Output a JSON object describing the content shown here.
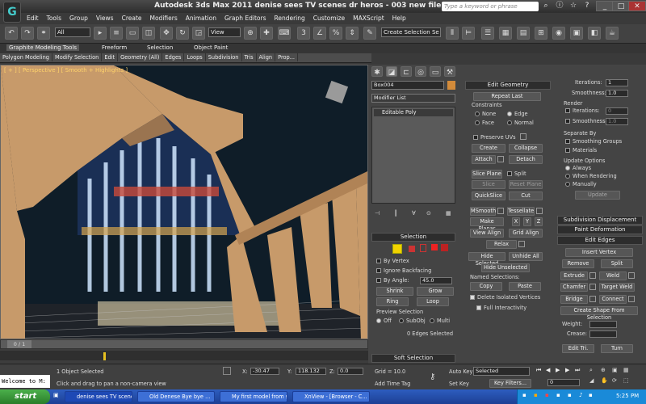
{
  "window": {
    "title": "Autodesk 3ds Max  2011      denise sees TV scenes dr heros - 003  new file with tv.max",
    "search_placeholder": "Type a keyword or phrase"
  },
  "menu": [
    "Edit",
    "Tools",
    "Group",
    "Views",
    "Create",
    "Modifiers",
    "Animation",
    "Graph Editors",
    "Rendering",
    "Customize",
    "MAXScript",
    "Help"
  ],
  "toolbar": {
    "filter": "All",
    "refcoord": "View",
    "selection_set": "Create Selection Se"
  },
  "ribbon": {
    "tabs": [
      "Graphite Modeling Tools",
      "Freeform",
      "Selection",
      "Object Paint"
    ],
    "items": [
      "Polygon Modeling",
      "Modify Selection",
      "Edit",
      "Geometry (All)",
      "Edges",
      "Loops",
      "Subdivision",
      "Tris",
      "Align",
      "Prop..."
    ]
  },
  "viewport": {
    "label": "[ + ] [ Perspective ] [ Smooth + Highlights ]"
  },
  "command_panel": {
    "object_name": "Box004",
    "modifier_list": "Modifier List",
    "stack_item": "Editable Poly",
    "selection": {
      "title": "Selection",
      "by_vertex": "By Vertex",
      "ignore_backfacing": "Ignore Backfacing",
      "by_angle": "By Angle:",
      "angle_value": "45.0",
      "shrink": "Shrink",
      "grow": "Grow",
      "ring": "Ring",
      "loop": "Loop",
      "preview_title": "Preview Selection",
      "off": "Off",
      "subobj": "SubObj",
      "multi": "Multi",
      "status": "0 Edges Selected"
    },
    "soft_selection": "Soft Selection"
  },
  "edit_geometry": {
    "title": "Edit Geometry",
    "repeat_last": "Repeat Last",
    "constraints": "Constraints",
    "none": "None",
    "edge": "Edge",
    "face": "Face",
    "normal": "Normal",
    "preserve_uvs": "Preserve UVs",
    "create": "Create",
    "collapse": "Collapse",
    "attach": "Attach",
    "detach": "Detach",
    "slice_plane": "Slice Plane",
    "split": "Split",
    "slice": "Slice",
    "reset_plane": "Reset Plane",
    "quickslice": "QuickSlice",
    "cut": "Cut",
    "msmooth": "MSmooth",
    "tessellate": "Tessellate",
    "make_planar": "Make Planar",
    "x": "X",
    "y": "Y",
    "z": "Z",
    "view_align": "View Align",
    "grid_align": "Grid Align",
    "relax": "Relax",
    "hide_selected": "Hide Selected",
    "unhide_all": "Unhide All",
    "hide_unselected": "Hide Unselected",
    "named_selections": "Named Selections:",
    "copy": "Copy",
    "paste": "Paste",
    "delete_isolated": "Delete Isolated Vertices",
    "full_interactivity": "Full Interactivity"
  },
  "subdivision": {
    "iterations_label": "Iterations:",
    "iterations_value": "1",
    "smoothness_label": "Smoothness:",
    "smoothness_value": "1.0",
    "render": "Render",
    "render_iterations_value": "0",
    "render_smoothness_value": "1.0",
    "separate_by": "Separate By",
    "smoothing_groups": "Smoothing Groups",
    "materials": "Materials",
    "update_options": "Update Options",
    "always": "Always",
    "when_rendering": "When Rendering",
    "manually": "Manually",
    "update": "Update",
    "subdivision_displacement": "Subdivision Displacement",
    "paint_deformation": "Paint Deformation",
    "edit_edges": "Edit Edges",
    "insert_vertex": "Insert Vertex",
    "remove": "Remove",
    "split": "Split",
    "extrude": "Extrude",
    "weld": "Weld",
    "chamfer": "Chamfer",
    "target_weld": "Target Weld",
    "bridge": "Bridge",
    "connect": "Connect",
    "create_shape": "Create Shape From Selection",
    "weight": "Weight:",
    "crease": "Crease:",
    "edit_tri": "Edit Tri.",
    "turn": "Turn"
  },
  "timeline": {
    "frame": "0 / 1"
  },
  "status": {
    "welcome": "Welcome to M:",
    "selected": "1 Object Selected",
    "prompt": "Click and drag to pan a non-camera view",
    "x_label": "X:",
    "x_value": "-30.47",
    "y_label": "Y:",
    "y_value": "118.132",
    "z_label": "Z:",
    "z_value": "0.0",
    "grid": "Grid = 10.0",
    "add_time_tag": "Add Time Tag",
    "auto_key": "Auto Key",
    "set_key": "Set Key",
    "key_mode": "Selected",
    "key_filters": "Key Filters...",
    "frame_value": "0"
  },
  "taskbar": {
    "start": "start",
    "tasks": [
      "denise sees TV scene...",
      "Old Denese Bye bye ...",
      "My first model from s...",
      "XnView - [Browser - C..."
    ],
    "clock": "5:25 PM"
  }
}
